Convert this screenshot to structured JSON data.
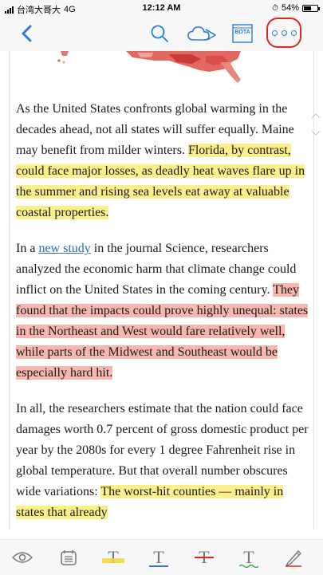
{
  "status_bar": {
    "carrier": "台湾大哥大",
    "network": "4G",
    "time": "12:12 AM",
    "battery": "54%",
    "battery_level": 0.54
  },
  "toolbar": {
    "back_icon": "chevron-left-icon",
    "search_icon": "search-icon",
    "cloud_icon": "cloud-icon",
    "bookmarks_label": "BOTA",
    "more_icon": "more-dots-icon",
    "accent": "#2a7fd4",
    "more_highlight": "#e0271c"
  },
  "article": {
    "p1_plain": "As the United States confronts global warming in the decades ahead, not all states will suffer equally. Maine may benefit from milder winters. ",
    "p1_highlight": "Florida, by contrast, could face major losses, as deadly heat waves flare up in the summer and rising sea levels eat away at valuable coastal properties.",
    "p2_pre": "In a ",
    "p2_link": "new study",
    "p2_mid": " in the journal Science, researchers analyzed the economic harm that climate change could inflict on the United States in the coming century. ",
    "p2_highlight": "They found that the impacts could prove highly unequal: states in the Northeast and West would fare relatively well, while parts of the Midwest and Southeast would be especially hard hit.",
    "p3_plain": "In all, the researchers estimate that the nation could face damages worth 0.7 percent of gross domestic product per year by the 2080s for every 1 degree Fahrenheit rise in global temperature. But that overall number obscures wide variations: ",
    "p3_highlight": "The worst-hit counties — mainly in states that already"
  },
  "highlight_colors": {
    "yellow": "#fbef8b",
    "red": "#f6b7ae"
  },
  "bottom_bar": {
    "tools": [
      {
        "icon": "eye-icon"
      },
      {
        "icon": "notes-icon"
      },
      {
        "icon": "highlight-text-icon",
        "letter": "T",
        "color": "#f2d53c"
      },
      {
        "icon": "underline-text-icon",
        "letter": "T",
        "color": "#3b6fd6"
      },
      {
        "icon": "strikethrough-text-icon",
        "letter": "T",
        "color": "#e0271c"
      },
      {
        "icon": "squiggly-text-icon",
        "letter": "T",
        "color": "#3fb04a"
      },
      {
        "icon": "pencil-icon"
      }
    ]
  }
}
